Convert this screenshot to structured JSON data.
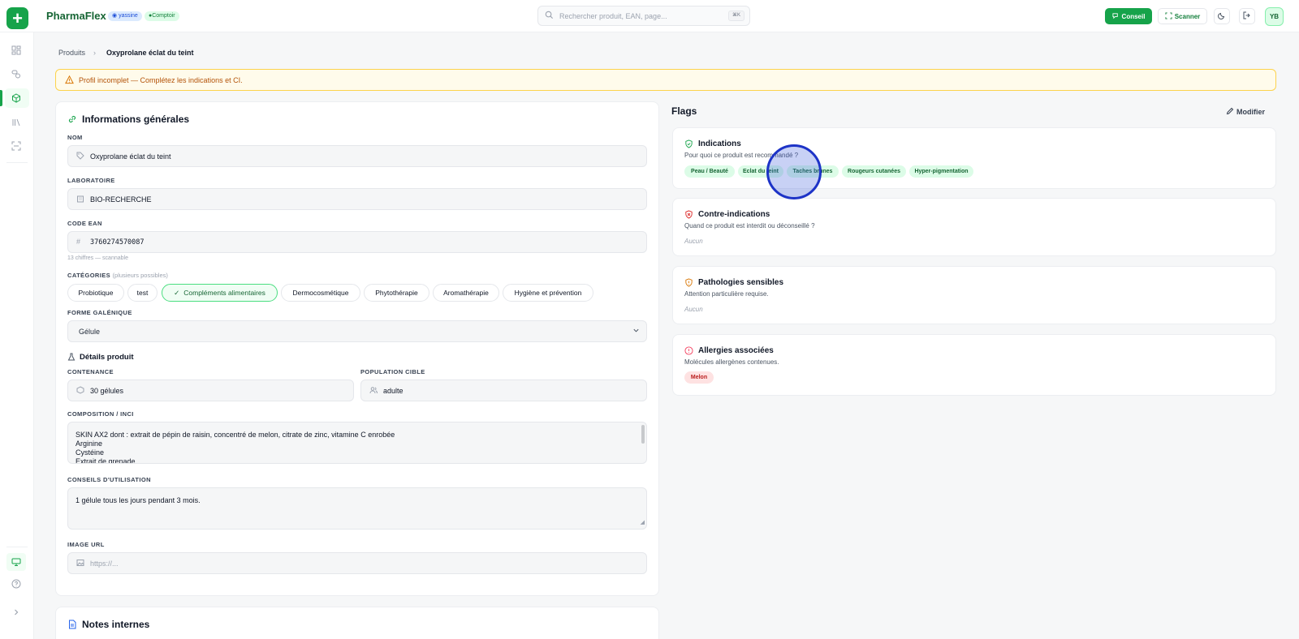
{
  "header": {
    "brand": "PharmaFlex",
    "user_badge": "yassine",
    "mode_badge": "Comptoir",
    "search_placeholder": "Rechercher produit, EAN, page...",
    "search_shortcut": "⌘K",
    "conseil_label": "Conseil",
    "scanner_label": "Scanner",
    "avatar_initials": "YB"
  },
  "breadcrumb": {
    "parent": "Produits",
    "current": "Oxyprolane éclat du teint"
  },
  "alert": {
    "text": "Profil incomplet — Complétez les indications et CI."
  },
  "general": {
    "title": "Informations générales",
    "nom_label": "NOM",
    "nom_value": "Oxyprolane éclat du teint",
    "labo_label": "LABORATOIRE",
    "labo_value": "BIO-RECHERCHE",
    "ean_label": "CODE EAN",
    "ean_value": "3760274570087",
    "ean_hint": "13 chiffres — scannable",
    "categories_label": "CATÉGORIES",
    "categories_sub": "(plusieurs possibles)",
    "categories": [
      "Probiotique",
      "test",
      "Compléments alimentaires",
      "Dermocosmétique",
      "Phytothérapie",
      "Aromathérapie",
      "Hygiène et prévention"
    ],
    "forme_label": "FORME GALÉNIQUE",
    "forme_value": "Gélule"
  },
  "details": {
    "title": "Détails produit",
    "contenance_label": "CONTENANCE",
    "contenance_value": "30 gélules",
    "population_label": "POPULATION CIBLE",
    "population_value": "adulte",
    "composition_label": "COMPOSITION / INCI",
    "composition_lines": [
      "SKIN AX2 dont : extrait de pépin de raisin, concentré de melon, citrate de zinc, vitamine C enrobée",
      "Arginine",
      "Cystéine",
      "Extrait de grenade"
    ],
    "conseils_label": "CONSEILS D'UTILISATION",
    "conseils_value": "1 gélule tous les jours pendant 3 mois.",
    "image_label": "IMAGE URL",
    "image_placeholder": "https://..."
  },
  "notes": {
    "title": "Notes internes"
  },
  "flags": {
    "title": "Flags",
    "edit_label": "Modifier",
    "indications": {
      "title": "Indications",
      "desc": "Pour quoi ce produit est recommandé ?",
      "tags": [
        "Peau / Beauté",
        "Eclat du teint",
        "Taches brunes",
        "Rougeurs cutanées",
        "Hyper-pigmentation"
      ]
    },
    "contre": {
      "title": "Contre-indications",
      "desc": "Quand ce produit est interdit ou déconseillé ?",
      "empty": "Aucun"
    },
    "pathologies": {
      "title": "Pathologies sensibles",
      "desc": "Attention particulière requise.",
      "empty": "Aucun"
    },
    "allergies": {
      "title": "Allergies associées",
      "desc": "Molécules allergènes contenues.",
      "tags": [
        "Melon"
      ]
    }
  },
  "colors": {
    "brand": "#16a34a",
    "alert_text": "#b45309",
    "tag_green_bg": "#dcfce7",
    "tag_red_bg": "#fee2e2"
  }
}
